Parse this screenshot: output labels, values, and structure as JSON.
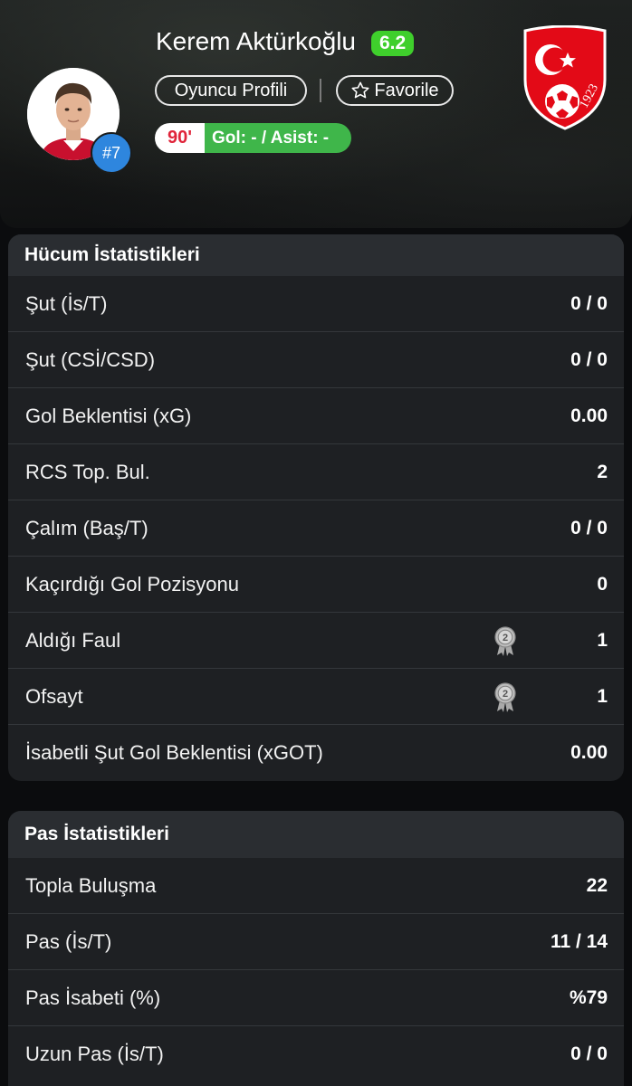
{
  "player": {
    "name": "Kerem Aktürkoğlu",
    "rating": "6.2",
    "jersey": "#7",
    "profile_label": "Oyuncu Profili",
    "favorite_label": "Favorile",
    "minutes": "90'",
    "goal_assist": "Gol: - / Asist: -",
    "crest_year": "1923"
  },
  "colors": {
    "rating_green": "#3fcf2c",
    "goal_bar_green": "#3fb64a",
    "minute_red": "#e0243a",
    "jersey_blue": "#2e86de",
    "crest_red": "#e30a17"
  },
  "attack": {
    "title": "Hücum İstatistikleri",
    "rows": [
      {
        "label": "Şut (İs/T)",
        "value": "0 / 0"
      },
      {
        "label": "Şut (CSİ/CSD)",
        "value": "0 / 0"
      },
      {
        "label": "Gol Beklentisi (xG)",
        "value": "0.00"
      },
      {
        "label": "RCS Top. Bul.",
        "value": "2"
      },
      {
        "label": "Çalım (Baş/T)",
        "value": "0 / 0"
      },
      {
        "label": "Kaçırdığı Gol Pozisyonu",
        "value": "0"
      },
      {
        "label": "Aldığı Faul",
        "value": "1",
        "medal": "2"
      },
      {
        "label": "Ofsayt",
        "value": "1",
        "medal": "2"
      },
      {
        "label": "İsabetli Şut Gol Beklentisi (xGOT)",
        "value": "0.00"
      }
    ]
  },
  "passing": {
    "title": "Pas İstatistikleri",
    "rows": [
      {
        "label": "Topla Buluşma",
        "value": "22"
      },
      {
        "label": "Pas (İs/T)",
        "value": "11 / 14"
      },
      {
        "label": "Pas İsabeti (%)",
        "value": "%79"
      },
      {
        "label": "Uzun Pas (İs/T)",
        "value": "0 / 0"
      }
    ]
  }
}
